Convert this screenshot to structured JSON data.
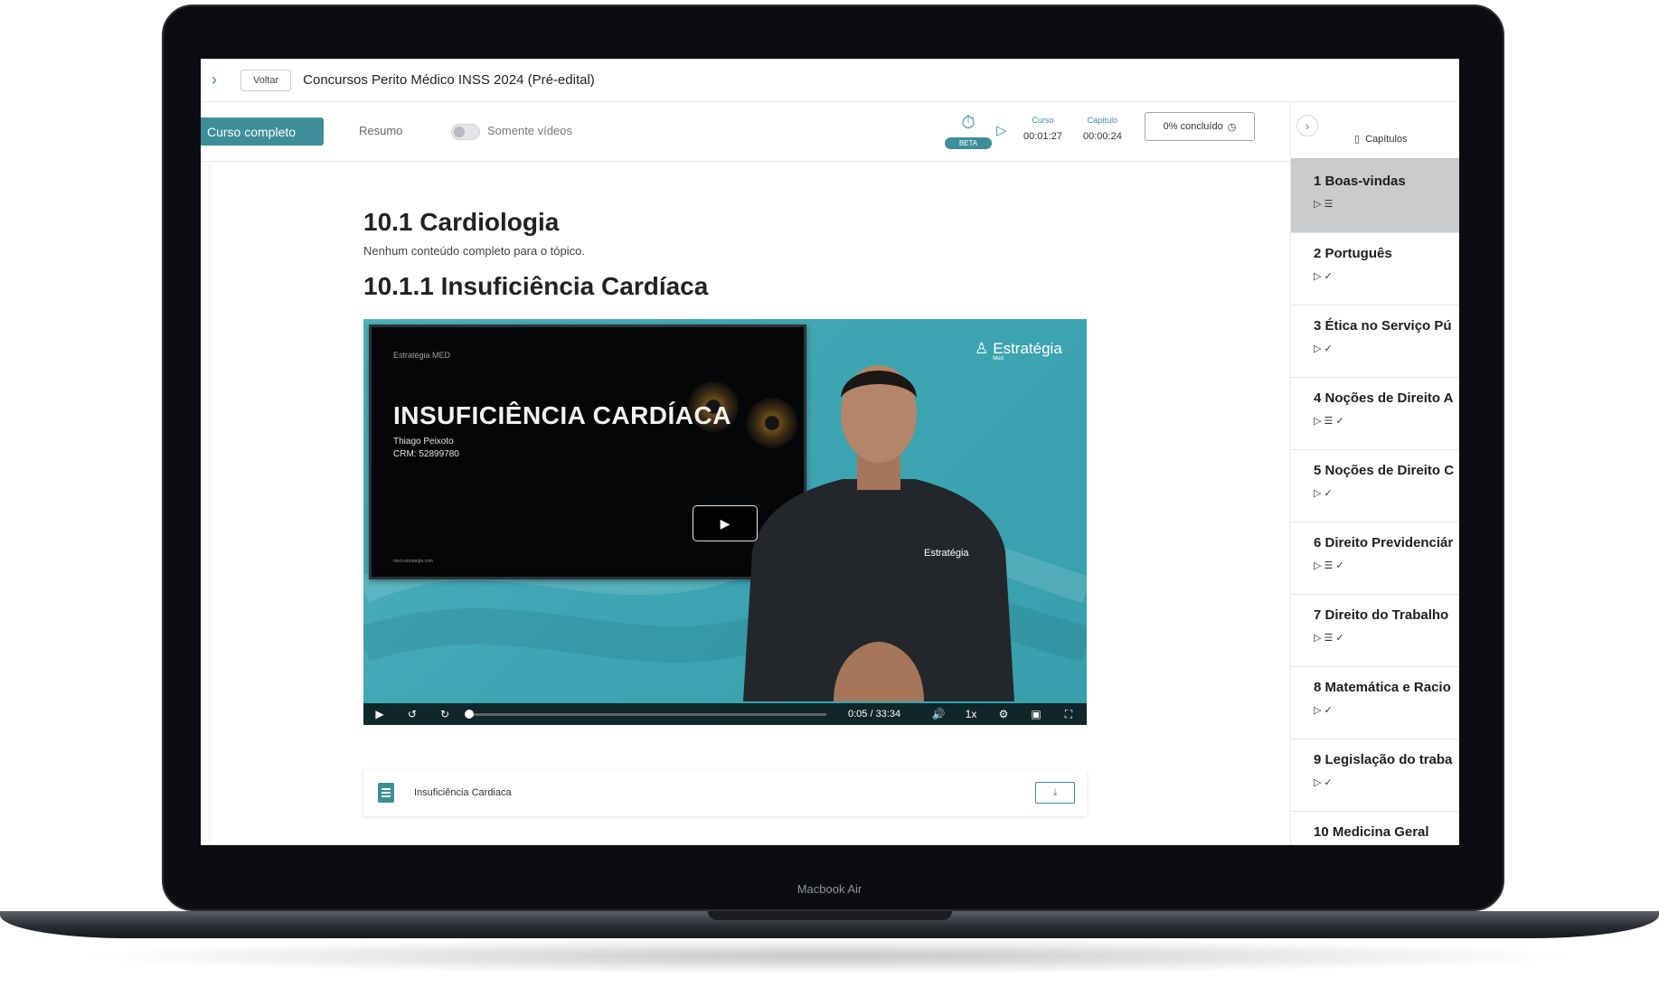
{
  "device": {
    "label": "Macbook Air"
  },
  "header": {
    "back_label": "Voltar",
    "course_title": "Concursos Perito Médico INSS 2024 (Pré-edital)"
  },
  "toolbar": {
    "tab_full": "Curso completo",
    "tab_summary": "Resumo",
    "toggle_label": "Somente vídeos",
    "beta": "BETA",
    "course_label": "Curso",
    "course_time": "00:01:27",
    "chapter_label": "Capítulo",
    "chapter_time": "00:00:24",
    "progress_label": "0% concluído"
  },
  "content": {
    "topic_title": "10.1 Cardiologia",
    "topic_note": "Nenhum conteúdo completo para o tópico.",
    "subtopic_title": "10.1.1 Insuficiência Cardíaca"
  },
  "video": {
    "slide_brand": "Estratégia MED",
    "slide_title": "INSUFICIÊNCIA CARDÍACA",
    "slide_author": "Thiago Peixoto",
    "slide_crm": "CRM: 52899780",
    "slide_footer": "med.estrategia.com",
    "logo_text": "Estratégia",
    "logo_sub": "Med",
    "shirt_logo": "Estratégia",
    "current_time": "0:05",
    "duration": "33:34",
    "speed": "1x",
    "progress_fraction": 0.01
  },
  "attachment": {
    "name": "Insuficiência Cardiaca"
  },
  "sidebar": {
    "title": "Capítulos",
    "chapters": [
      {
        "name": "1 Boas-vindas",
        "icons": "▷  ☰"
      },
      {
        "name": "2 Português",
        "icons": "▷  ✓"
      },
      {
        "name": "3 Ética no Serviço Pú",
        "icons": "▷  ✓"
      },
      {
        "name": "4 Noções de Direito A",
        "icons": "▷  ☰  ✓"
      },
      {
        "name": "5 Noções de Direito C",
        "icons": "▷  ✓"
      },
      {
        "name": "6 Direito Previdenciár",
        "icons": "▷  ☰  ✓"
      },
      {
        "name": "7 Direito do Trabalho",
        "icons": "▷  ☰  ✓"
      },
      {
        "name": "8 Matemática e Racio",
        "icons": "▷  ✓"
      },
      {
        "name": "9 Legislação do traba",
        "icons": "▷  ✓"
      },
      {
        "name": "10 Medicina Geral",
        "icons": ""
      }
    ]
  },
  "colors": {
    "accent": "#3d8e99",
    "video_bg": "#3ea5b2"
  }
}
